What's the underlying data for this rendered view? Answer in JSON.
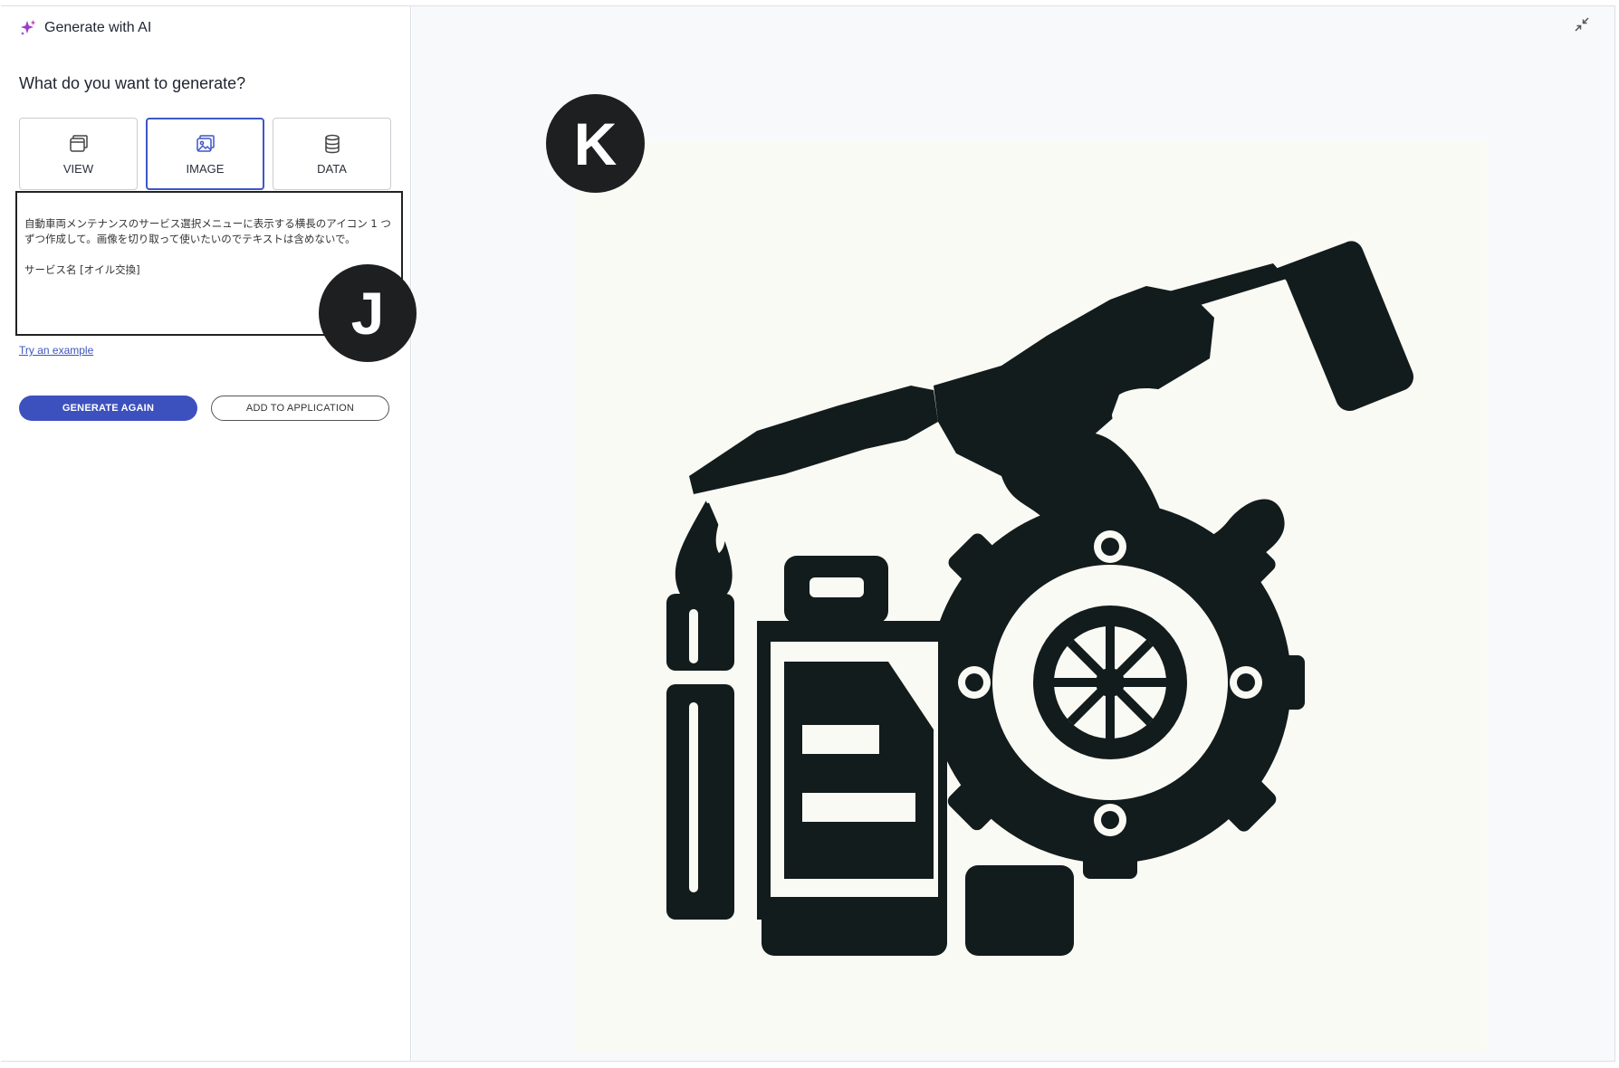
{
  "header": {
    "title": "Generate with AI",
    "icon": "sparkle-icon",
    "icon_color": "#9b3cc9"
  },
  "main": {
    "question": "What do you want to generate?",
    "types": [
      {
        "label": "VIEW",
        "icon": "view-window-icon",
        "selected": false
      },
      {
        "label": "IMAGE",
        "icon": "image-icon",
        "selected": true
      },
      {
        "label": "DATA",
        "icon": "database-icon",
        "selected": false
      }
    ],
    "prompt": "自動車両メンテナンスのサービス選択メニューに表示する横長のアイコン 1 つずつ作成して。画像を切り取って使いたいのでテキストは含めないで。\n\nサービス名 [オイル交換]",
    "try_example": "Try an example",
    "generate_again": "GENERATE AGAIN",
    "add_to_application": "ADD TO APPLICATION"
  },
  "markers": {
    "j": "J",
    "k": "K"
  },
  "preview": {
    "icon": "oil-change-icon",
    "collapse_icon": "collapse-icon"
  },
  "colors": {
    "accent": "#3d51be",
    "marker": "#1e1f21",
    "icon_fill": "#131c1c"
  }
}
